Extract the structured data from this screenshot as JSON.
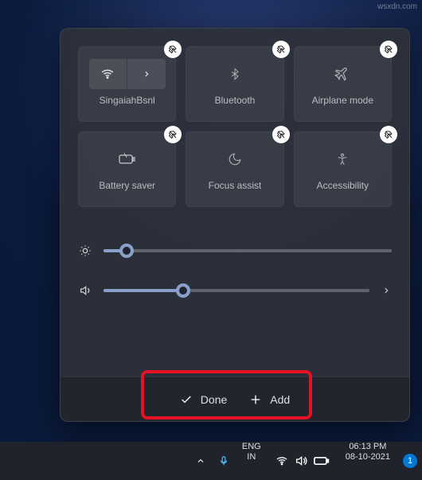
{
  "watermark": "wsxdn.com",
  "tiles": [
    {
      "label": "SingaiahBsnl"
    },
    {
      "label": "Bluetooth"
    },
    {
      "label": "Airplane mode"
    },
    {
      "label": "Battery saver"
    },
    {
      "label": "Focus assist"
    },
    {
      "label": "Accessibility"
    }
  ],
  "sliders": {
    "brightness": 8,
    "volume": 30
  },
  "footer": {
    "done": "Done",
    "add": "Add"
  },
  "taskbar": {
    "lang1": "ENG",
    "lang2": "IN",
    "time": "06:13 PM",
    "date": "08-10-2021",
    "notif": "1"
  }
}
